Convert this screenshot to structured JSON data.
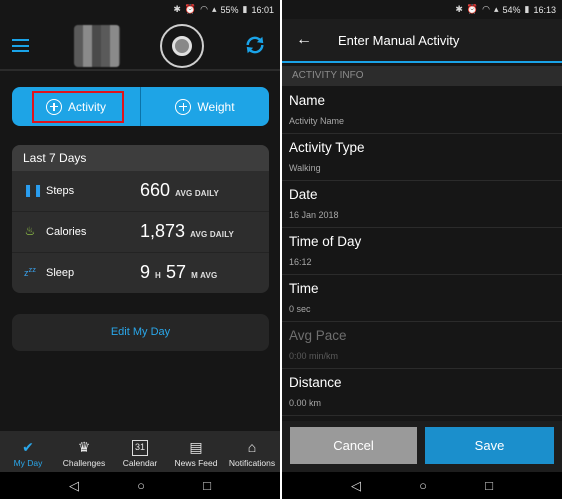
{
  "left": {
    "status": {
      "battery": "55%",
      "time": "16:01"
    },
    "header": {
      "menu_icon": "hamburger-icon",
      "device_icon": "watch-icon",
      "sync_icon": "sync-icon"
    },
    "add_pill": {
      "activity_label": "Activity",
      "weight_label": "Weight"
    },
    "summary": {
      "title": "Last 7 Days",
      "rows": [
        {
          "icon": "footsteps-icon",
          "label": "Steps",
          "value": "660",
          "unit": "AVG DAILY"
        },
        {
          "icon": "flame-icon",
          "label": "Calories",
          "value": "1,873",
          "unit": "AVG DAILY"
        },
        {
          "icon": "zzz-icon",
          "label": "Sleep",
          "hours": "9",
          "h_unit": "H",
          "minutes": "57",
          "m_unit": "M AVG"
        }
      ]
    },
    "edit_day_label": "Edit My Day",
    "nav": [
      {
        "label": "My Day",
        "icon": "check-icon",
        "active": true
      },
      {
        "label": "Challenges",
        "icon": "laurel-icon",
        "active": false
      },
      {
        "label": "Calendar",
        "icon": "calendar-icon",
        "calendar_day": "31",
        "active": false
      },
      {
        "label": "News Feed",
        "icon": "newspaper-icon",
        "active": false
      },
      {
        "label": "Notifications",
        "icon": "inbox-icon",
        "active": false
      }
    ]
  },
  "right": {
    "status": {
      "battery": "54%",
      "time": "16:13"
    },
    "header": {
      "title": "Enter Manual Activity",
      "back_icon": "arrow-left-icon"
    },
    "section_label": "ACTIVITY INFO",
    "fields": [
      {
        "label": "Name",
        "value": "Activity Name"
      },
      {
        "label": "Activity Type",
        "value": "Walking"
      },
      {
        "label": "Date",
        "value": "16 Jan 2018"
      },
      {
        "label": "Time of Day",
        "value": "16:12"
      },
      {
        "label": "Time",
        "value": "0 sec"
      },
      {
        "label": "Avg Pace",
        "value": "0:00 min/km"
      },
      {
        "label": "Distance",
        "value": "0.00 km"
      }
    ],
    "cancel_label": "Cancel",
    "save_label": "Save"
  },
  "system_nav": {
    "back_icon": "triangle-back-icon",
    "home_icon": "circle-home-icon",
    "recents_icon": "square-recents-icon"
  }
}
